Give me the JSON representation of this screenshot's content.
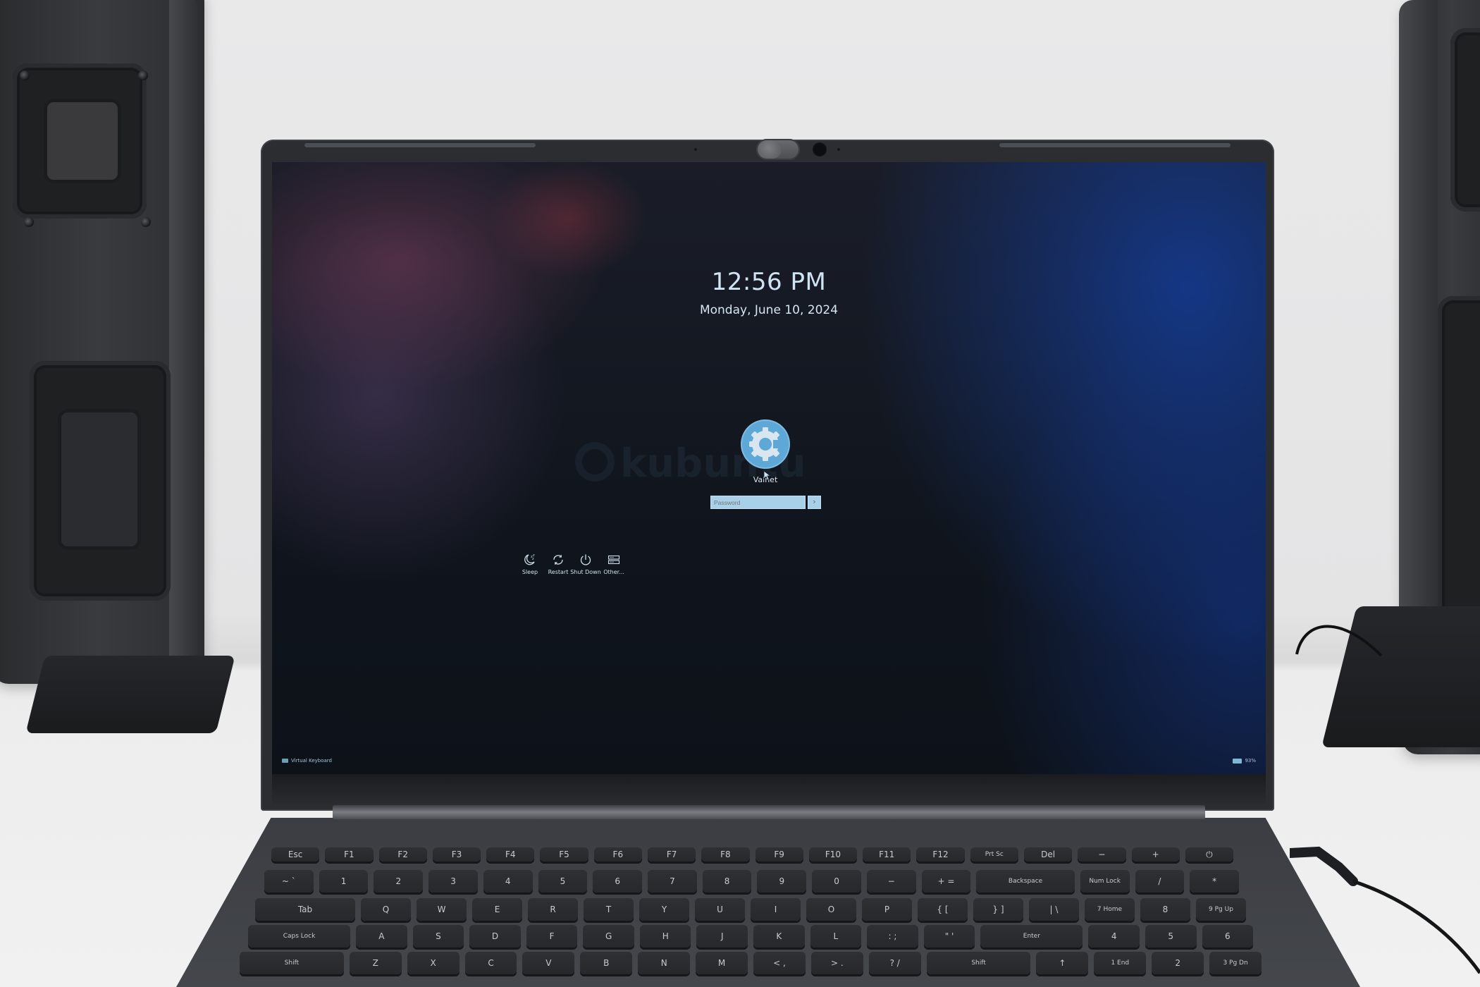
{
  "lockscreen": {
    "time": "12:56 PM",
    "date": "Monday, June 10, 2024",
    "watermark": "kubuntu",
    "user": {
      "name": "Valnet",
      "avatar_icon": "kubuntu-gear-logo"
    },
    "password": {
      "value": "",
      "placeholder": "Password",
      "submit_glyph": "›"
    },
    "actions": [
      {
        "label": "Sleep",
        "icon": "sleep-moon-icon"
      },
      {
        "label": "Restart",
        "icon": "restart-icon"
      },
      {
        "label": "Shut Down",
        "icon": "power-icon"
      },
      {
        "label": "Other...",
        "icon": "switch-user-icon"
      }
    ],
    "footer": {
      "virtual_keyboard": "Virtual Keyboard",
      "battery": "93%"
    }
  },
  "colors": {
    "accent": "#5ea8d8",
    "field": "#a9d0e9",
    "text": "#cfe3f2"
  },
  "keyboard": {
    "rows": [
      [
        "Esc",
        "F1",
        "F2",
        "F3",
        "F4",
        "F5",
        "F6",
        "F7",
        "F8",
        "F9",
        "F10",
        "F11",
        "F12",
        "Prt Sc",
        "Del",
        "−",
        "+",
        "⏻"
      ],
      [
        "~ `",
        "1",
        "2",
        "3",
        "4",
        "5",
        "6",
        "7",
        "8",
        "9",
        "0",
        "−",
        "+ =",
        "Backspace",
        "Num Lock",
        "/",
        "*"
      ],
      [
        "Tab",
        "Q",
        "W",
        "E",
        "R",
        "T",
        "Y",
        "U",
        "I",
        "O",
        "P",
        "{ [",
        "} ]",
        "| \\",
        "7 Home",
        "8",
        "9 Pg Up"
      ],
      [
        "Caps Lock",
        "A",
        "S",
        "D",
        "F",
        "G",
        "H",
        "J",
        "K",
        "L",
        ": ;",
        "\" '",
        "Enter",
        "4",
        "5",
        "6"
      ],
      [
        "Shift",
        "Z",
        "X",
        "C",
        "V",
        "B",
        "N",
        "M",
        "< ,",
        "> .",
        "? /",
        "Shift",
        "↑",
        "1 End",
        "2",
        "3 Pg Dn"
      ]
    ]
  }
}
